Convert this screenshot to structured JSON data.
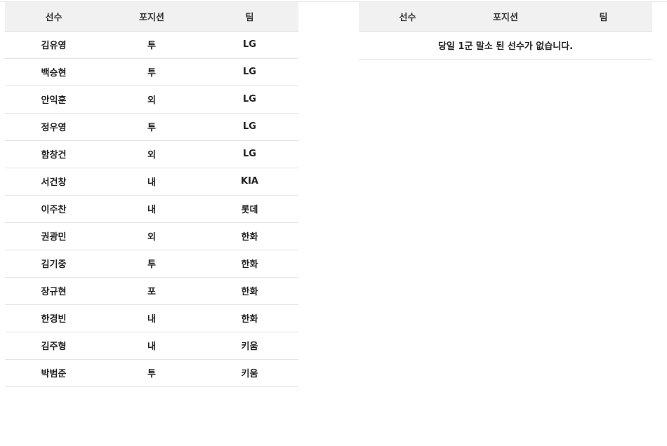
{
  "left_table": {
    "headers": [
      "선수",
      "포지션",
      "팀"
    ],
    "rows": [
      {
        "player": "김유영",
        "position": "투",
        "team": "LG"
      },
      {
        "player": "백승현",
        "position": "투",
        "team": "LG"
      },
      {
        "player": "안익훈",
        "position": "외",
        "team": "LG"
      },
      {
        "player": "정우영",
        "position": "투",
        "team": "LG"
      },
      {
        "player": "함창건",
        "position": "외",
        "team": "LG"
      },
      {
        "player": "서건창",
        "position": "내",
        "team": "KIA"
      },
      {
        "player": "이주찬",
        "position": "내",
        "team": "롯데"
      },
      {
        "player": "권광민",
        "position": "외",
        "team": "한화"
      },
      {
        "player": "김기중",
        "position": "투",
        "team": "한화"
      },
      {
        "player": "장규현",
        "position": "포",
        "team": "한화"
      },
      {
        "player": "한경빈",
        "position": "내",
        "team": "한화"
      },
      {
        "player": "김주형",
        "position": "내",
        "team": "키움"
      },
      {
        "player": "박범준",
        "position": "투",
        "team": "키움"
      }
    ]
  },
  "right_table": {
    "headers": [
      "선수",
      "포지션",
      "팀"
    ],
    "empty_message": "당일 1군 말소 된 선수가 없습니다."
  }
}
